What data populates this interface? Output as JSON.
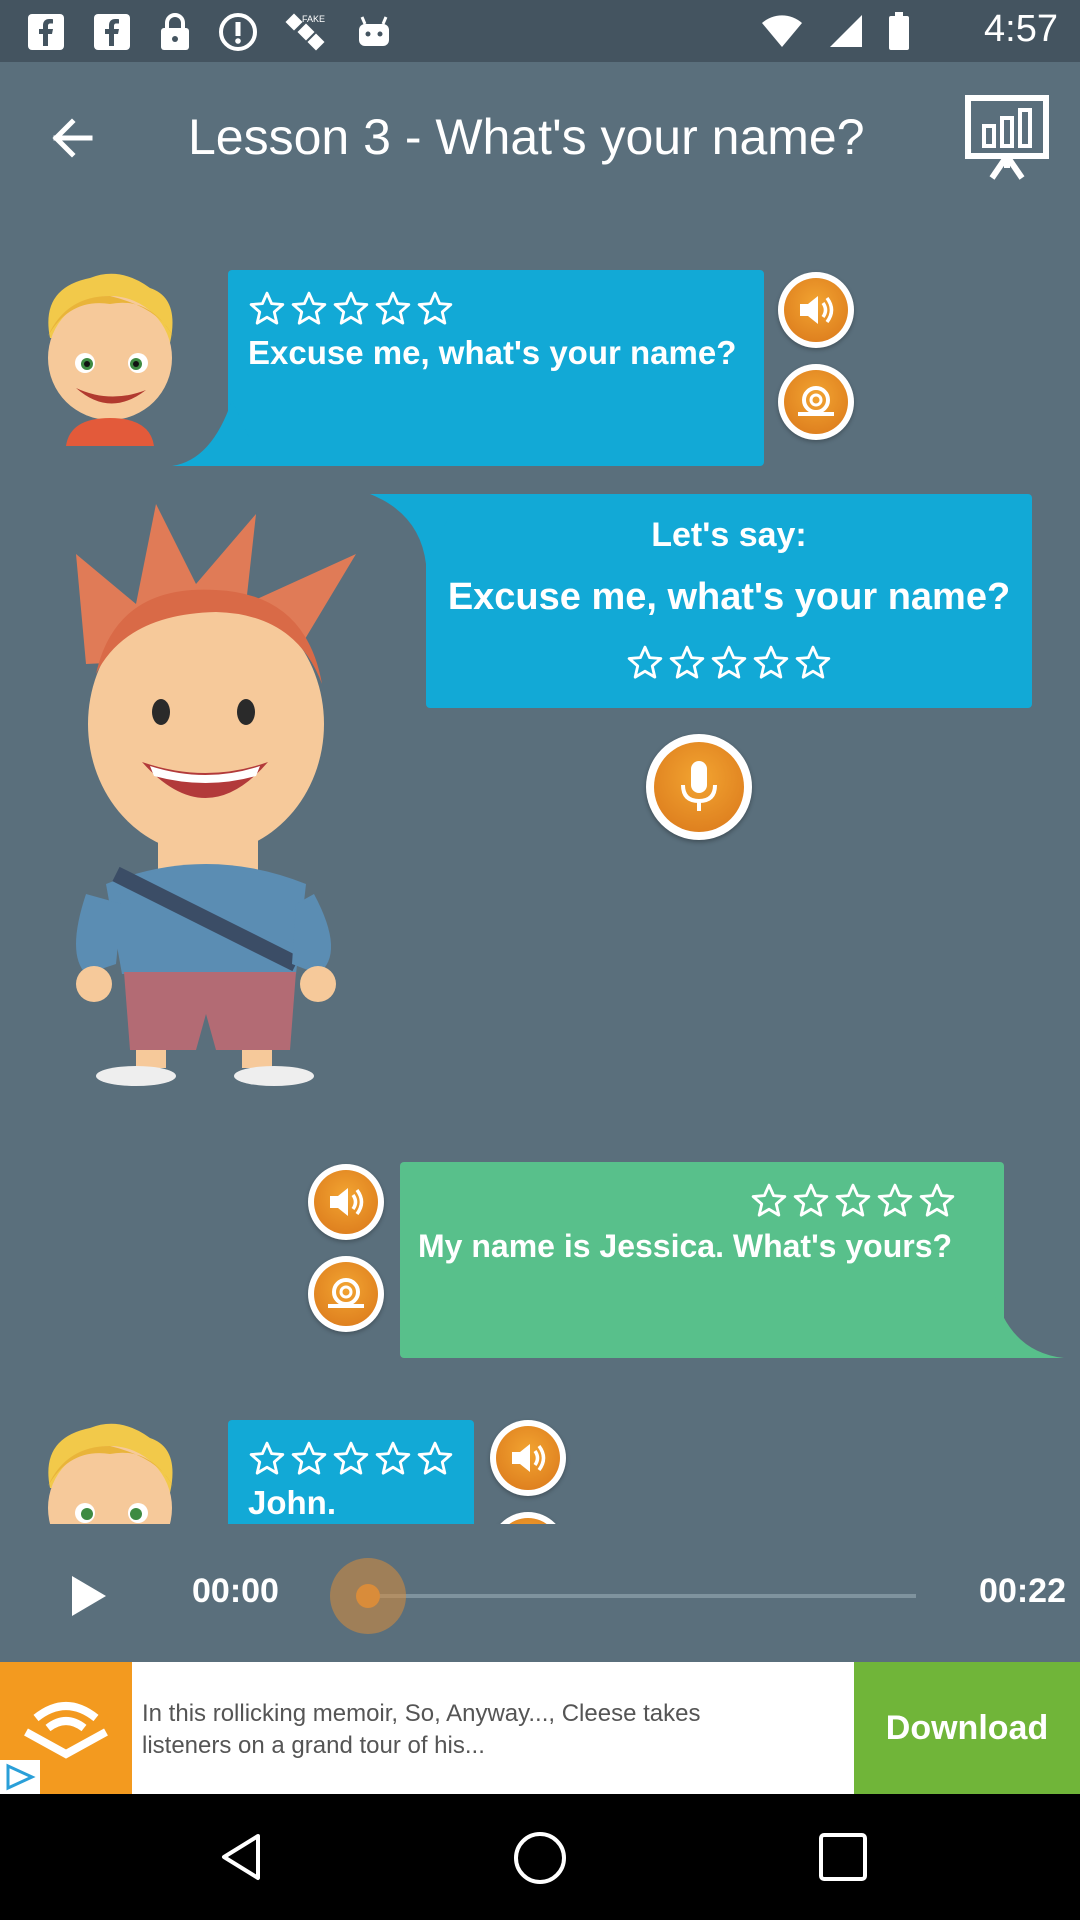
{
  "status_bar": {
    "time": "4:57",
    "left_icons": [
      "facebook-icon",
      "facebook-icon",
      "lock-icon",
      "info-icon",
      "satellite-icon",
      "android-icon"
    ],
    "right_icons": [
      "wifi-icon",
      "signal-icon",
      "battery-icon"
    ]
  },
  "header": {
    "title": "Lesson 3 - What's your name?",
    "back_icon": "arrow-left-icon",
    "progress_icon": "chart-board-icon"
  },
  "dialog": [
    {
      "speaker": "boy",
      "text": "Excuse me, what's your name?",
      "stars_total": 5,
      "stars_filled": 0,
      "bubble_color": "#12a9d6",
      "actions": [
        "speaker-icon",
        "slow-snail-icon"
      ]
    },
    {
      "speaker": "prompt",
      "heading": "Let's say:",
      "text": "Excuse me, what's your name?",
      "stars_total": 5,
      "stars_filled": 0,
      "bubble_color": "#12a9d6",
      "actions": [
        "microphone-icon"
      ]
    },
    {
      "speaker": "girl",
      "text": "My name is Jessica. What's yours?",
      "stars_total": 5,
      "stars_filled": 0,
      "bubble_color": "#58c08b",
      "actions": [
        "speaker-icon",
        "slow-snail-icon"
      ]
    },
    {
      "speaker": "boy",
      "text": "John.",
      "stars_total": 5,
      "stars_filled": 0,
      "bubble_color": "#12a9d6",
      "actions": [
        "speaker-icon"
      ]
    }
  ],
  "player": {
    "current_time": "00:00",
    "total_time": "00:22",
    "progress": 0.0
  },
  "ad": {
    "text": "In this rollicking memoir, So, Anyway..., Cleese takes listeners on a grand tour of his...",
    "cta": "Download",
    "logo_icon": "audible-logo-icon",
    "badge_icon": "ad-play-badge-icon"
  },
  "nav": {
    "back_icon": "nav-back-icon",
    "home_icon": "nav-home-icon",
    "recents_icon": "nav-recents-icon"
  },
  "colors": {
    "background": "#5a6f7c",
    "bubble_blue": "#12a9d6",
    "bubble_green": "#58c08b",
    "accent_orange": "#e8902a",
    "ad_green": "#70b539"
  }
}
